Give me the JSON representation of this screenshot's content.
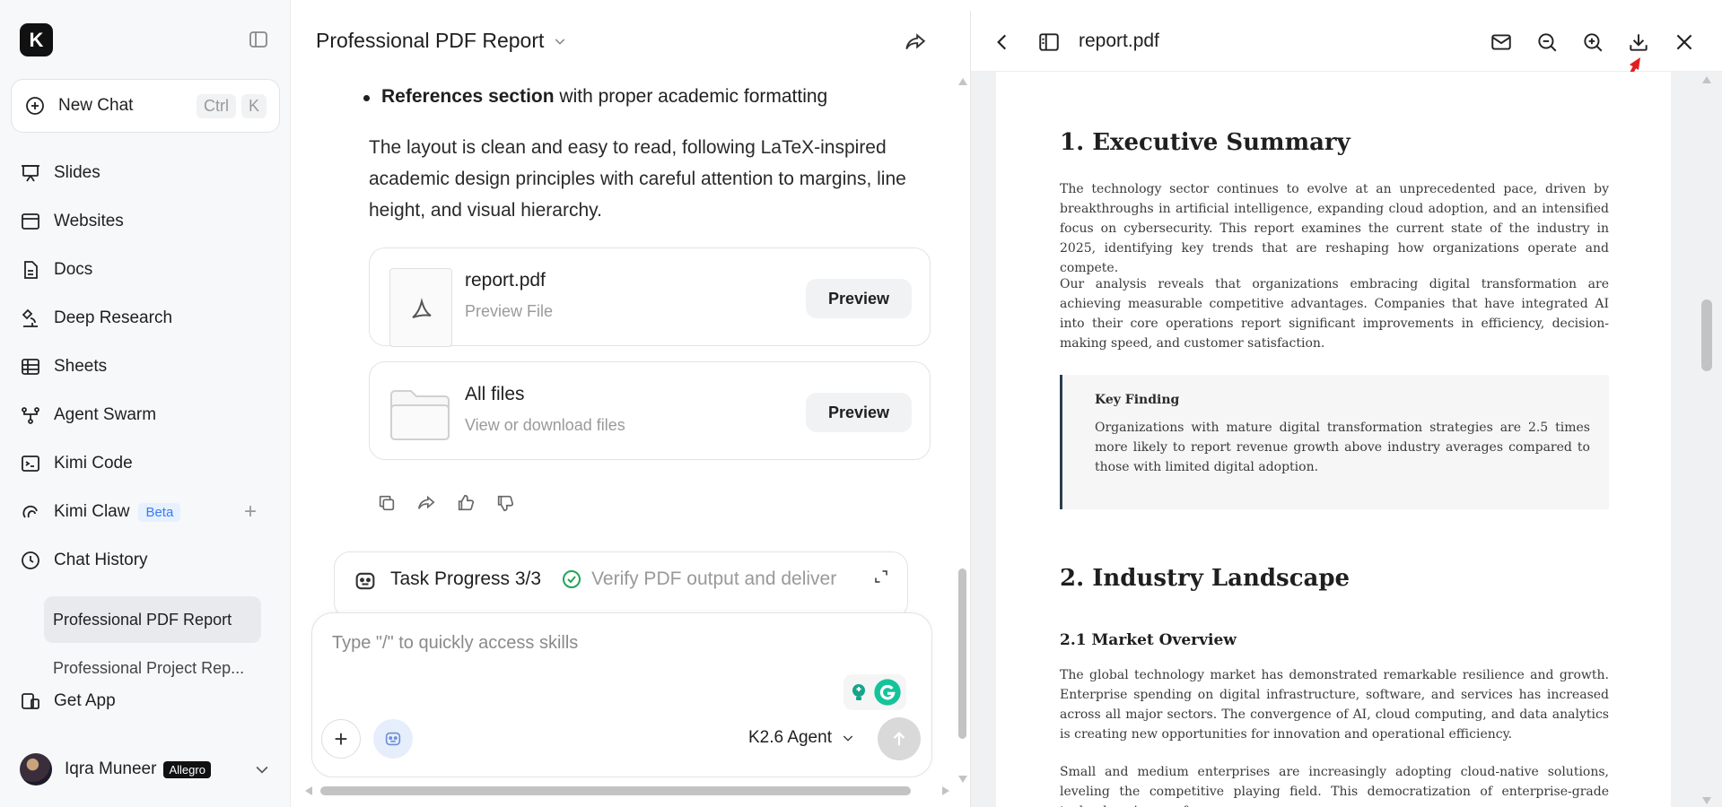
{
  "sidebar": {
    "logo": "K",
    "new_chat": {
      "label": "New Chat",
      "kbd1": "Ctrl",
      "kbd2": "K"
    },
    "nav": [
      {
        "label": "Slides",
        "icon": "presentation-icon"
      },
      {
        "label": "Websites",
        "icon": "browser-icon"
      },
      {
        "label": "Docs",
        "icon": "document-icon"
      },
      {
        "label": "Deep Research",
        "icon": "microscope-icon"
      },
      {
        "label": "Sheets",
        "icon": "table-icon"
      },
      {
        "label": "Agent Swarm",
        "icon": "swarm-icon"
      },
      {
        "label": "Kimi Code",
        "icon": "terminal-icon"
      },
      {
        "label": "Kimi Claw",
        "icon": "claw-icon",
        "badge": "Beta"
      },
      {
        "label": "Chat History",
        "icon": "clock-icon"
      }
    ],
    "history": [
      {
        "label": "Professional PDF Report",
        "active": true
      },
      {
        "label": "Professional Project Rep...",
        "active": false
      }
    ],
    "get_app": "Get App",
    "user": {
      "name": "Iqra Muneer",
      "plan": "Allegro"
    }
  },
  "chat": {
    "title": "Professional PDF Report",
    "bullet_bold": "References section",
    "bullet_rest": " with proper academic formatting",
    "paragraph": "The layout is clean and easy to read, following LaTeX-inspired academic design principles with careful attention to margins, line height, and visual hierarchy.",
    "files": [
      {
        "name": "report.pdf",
        "sub": "Preview File",
        "button": "Preview"
      },
      {
        "name": "All files",
        "sub": "View or download files",
        "button": "Preview"
      }
    ],
    "task": {
      "label": "Task Progress 3/3",
      "status": "Verify PDF output and deliver"
    },
    "composer": {
      "placeholder": "Type \"/\" to quickly access skills",
      "model": "K2.6 Agent"
    }
  },
  "viewer": {
    "filename": "report.pdf",
    "content": {
      "h1_exec": "1. Executive Summary",
      "p1": "The technology sector continues to evolve at an unprecedented pace, driven by breakthroughs in artificial intelligence, expanding cloud adoption, and an intensified focus on cybersecurity. This report examines the current state of the industry in 2025, identifying key trends that are reshaping how organizations operate and compete.",
      "p2": "Our analysis reveals that organizations embracing digital transformation are achieving measurable competitive advantages. Companies that have integrated AI into their core operations report significant improvements in efficiency, decision-making speed, and customer satisfaction.",
      "key_title": "Key Finding",
      "key_body": "Organizations with mature digital transformation strategies are 2.5 times more likely to report revenue growth above industry averages compared to those with limited digital adoption.",
      "h1_industry": "2. Industry Landscape",
      "h2_market": "2.1 Market Overview",
      "p3": "The global technology market has demonstrated remarkable resilience and growth. Enterprise spending on digital infrastructure, software, and services has increased across all major sectors. The convergence of AI, cloud computing, and data analytics is creating new opportunities for innovation and operational efficiency.",
      "p4": "Small and medium enterprises are increasingly adopting cloud-native solutions, leveling the competitive playing field. This democratization of enterprise-grade technology is one of"
    }
  },
  "colors": {
    "accent": "#3a7bf0",
    "success": "#22a559",
    "arrow": "#e02020",
    "quote_border": "#2c3e50"
  }
}
